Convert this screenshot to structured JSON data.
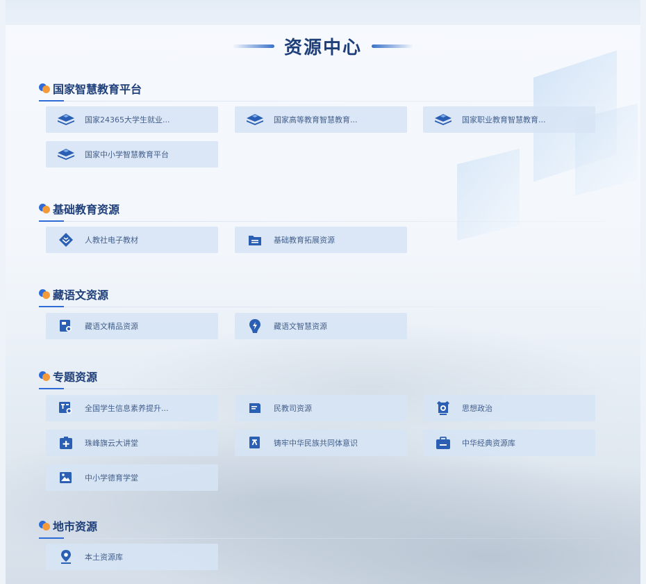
{
  "page_title": "资源中心",
  "sections": [
    {
      "title": "国家智慧教育平台",
      "items": [
        {
          "label": "国家24365大学生就业...",
          "icon": "book-stack-icon"
        },
        {
          "label": "国家高等教育智慧教育...",
          "icon": "book-stack-icon"
        },
        {
          "label": "国家职业教育智慧教育...",
          "icon": "book-stack-icon"
        },
        {
          "label": "国家中小学智慧教育平台",
          "icon": "book-stack-icon"
        }
      ]
    },
    {
      "title": "基础教育资源",
      "items": [
        {
          "label": "人教社电子教材",
          "icon": "diamond-book-icon"
        },
        {
          "label": "基础教育拓展资源",
          "icon": "folder-icon"
        }
      ]
    },
    {
      "title": "藏语文资源",
      "items": [
        {
          "label": "藏语文精品资源",
          "icon": "document-search-icon"
        },
        {
          "label": "藏语文智慧资源",
          "icon": "bulb-icon"
        }
      ]
    },
    {
      "title": "专题资源",
      "items": [
        {
          "label": "全国学生信息素养提升...",
          "icon": "text-search-icon"
        },
        {
          "label": "民教司资源",
          "icon": "book-open-icon"
        },
        {
          "label": "思想政治",
          "icon": "emblem-icon"
        },
        {
          "label": "珠峰旗云大讲堂",
          "icon": "medical-plus-icon"
        },
        {
          "label": "铸牢中华民族共同体意识",
          "icon": "text-doc-icon"
        },
        {
          "label": "中华经典资源库",
          "icon": "briefcase-icon"
        },
        {
          "label": "中小学德育学堂",
          "icon": "image-icon"
        }
      ]
    },
    {
      "title": "地市资源",
      "items": [
        {
          "label": "本土资源库",
          "icon": "location-pin-icon"
        }
      ]
    }
  ]
}
